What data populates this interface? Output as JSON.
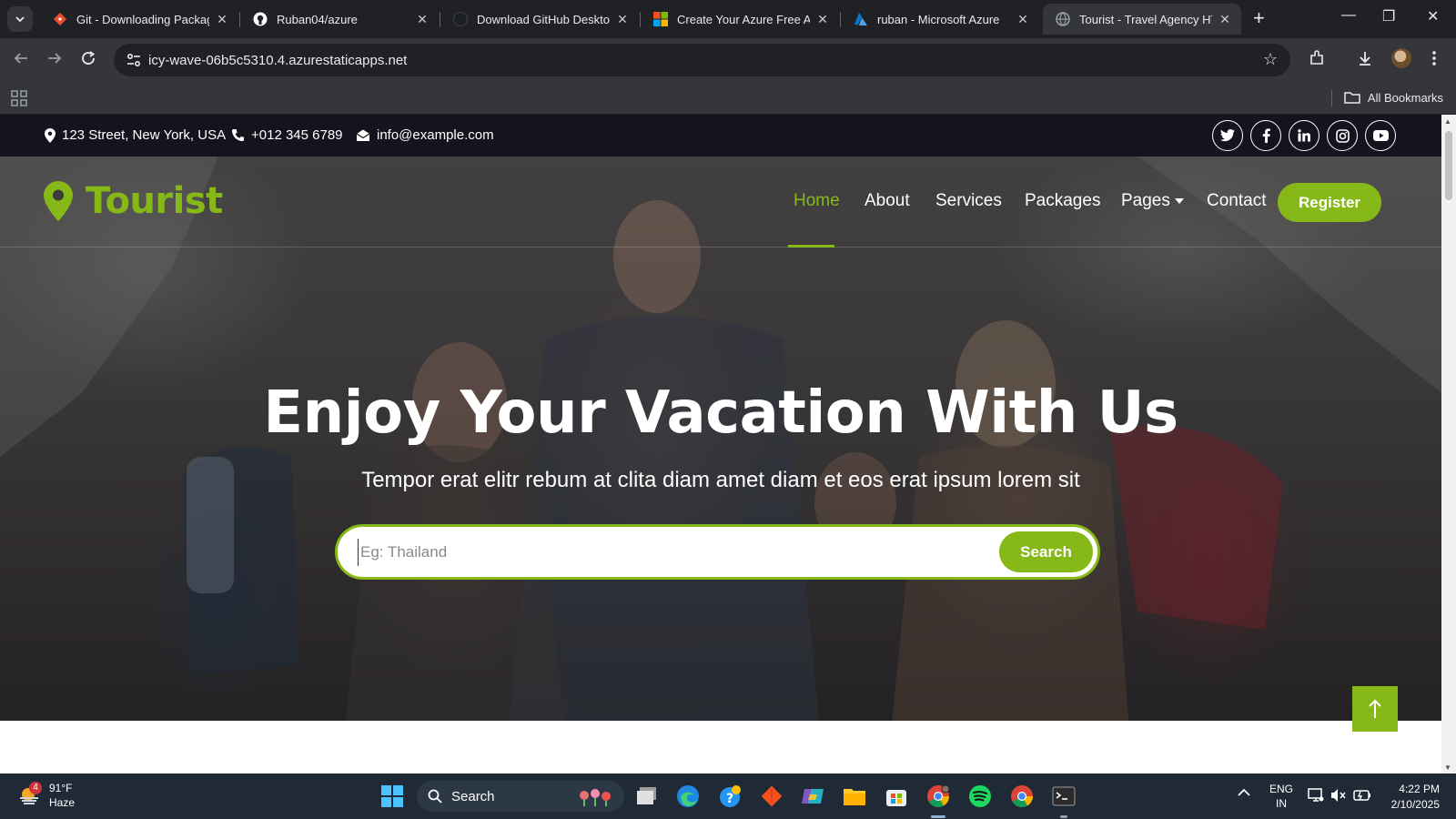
{
  "browser": {
    "tabs": [
      {
        "title": "Git - Downloading Package",
        "icon": "git-icon",
        "color": "#e84d31"
      },
      {
        "title": "Ruban04/azure",
        "icon": "github-icon",
        "color": "#ffffff"
      },
      {
        "title": "Download GitHub Desktop",
        "icon": "github-icon",
        "color": "#1b1f23"
      },
      {
        "title": "Create Your Azure Free Ac",
        "icon": "microsoft-icon",
        "color": "#f25022"
      },
      {
        "title": "ruban - Microsoft Azure",
        "icon": "azure-icon",
        "color": "#0078d4"
      },
      {
        "title": "Tourist - Travel Agency HT",
        "icon": "globe-icon",
        "color": "#9aa0a6",
        "active": true
      }
    ],
    "url": "icy-wave-06b5c5310.4.azurestaticapps.net",
    "bookmarks_label": "All Bookmarks"
  },
  "page": {
    "topbar": {
      "address": "123 Street, New York, USA",
      "phone": "+012 345 6789",
      "email": "info@example.com",
      "social": [
        "twitter-icon",
        "facebook-icon",
        "linkedin-icon",
        "instagram-icon",
        "youtube-icon"
      ]
    },
    "brand": {
      "name": "Tourist",
      "accent": "#86b817"
    },
    "nav": {
      "home": "Home",
      "about": "About",
      "services": "Services",
      "packages": "Packages",
      "pages": "Pages",
      "contact": "Contact",
      "register": "Register"
    },
    "hero": {
      "title": "Enjoy Your Vacation With Us",
      "subtitle": "Tempor erat elitr rebum at clita diam amet diam et eos erat ipsum lorem sit",
      "search_placeholder": "Eg: Thailand",
      "search_button": "Search"
    }
  },
  "taskbar": {
    "weather_temp": "91°F",
    "weather_desc": "Haze",
    "weather_badge": "4",
    "search_label": "Search",
    "lang_top": "ENG",
    "lang_bottom": "IN",
    "time": "4:22 PM",
    "date": "2/10/2025"
  }
}
